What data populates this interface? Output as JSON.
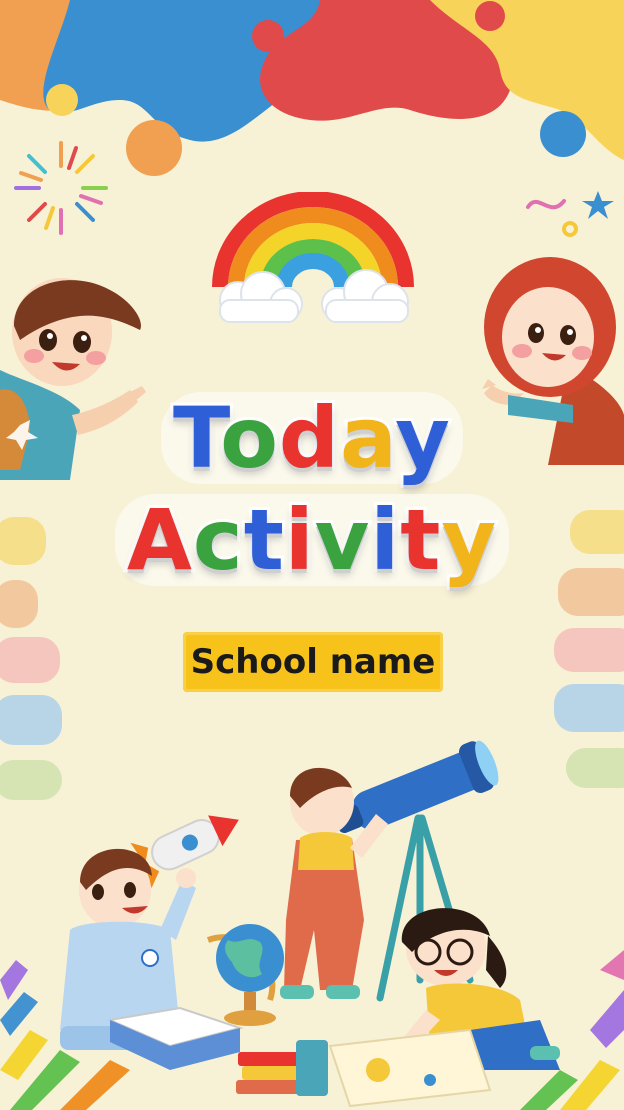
{
  "title": {
    "line1": [
      "T",
      "o",
      "d",
      "a",
      "y"
    ],
    "line2": [
      "A",
      "c",
      "t",
      "i",
      "v",
      "i",
      "t",
      "y"
    ],
    "line1_colors": [
      "#2f5fd6",
      "#3aa23e",
      "#e8332e",
      "#f1b51b",
      "#2f5fd6"
    ],
    "line2_colors": [
      "#e8332e",
      "#3aa23e",
      "#2f5fd6",
      "#e8332e",
      "#3aa23e",
      "#2f5fd6",
      "#e8332e",
      "#f1b51b"
    ]
  },
  "school_badge": "School name",
  "colors": {
    "background": "#f7f1d6",
    "badge": "#f7c31b",
    "blob_blue": "#3a8fd1",
    "blob_red": "#e04a4a",
    "blob_orange": "#f0a050",
    "blob_yellow": "#f8d35a"
  },
  "icons": [
    "rainbow-icon",
    "firework-icon",
    "confetti-icon",
    "boy-waving",
    "girl-waving",
    "telescope-icon",
    "globe-icon",
    "rocket-icon",
    "book-icon"
  ]
}
